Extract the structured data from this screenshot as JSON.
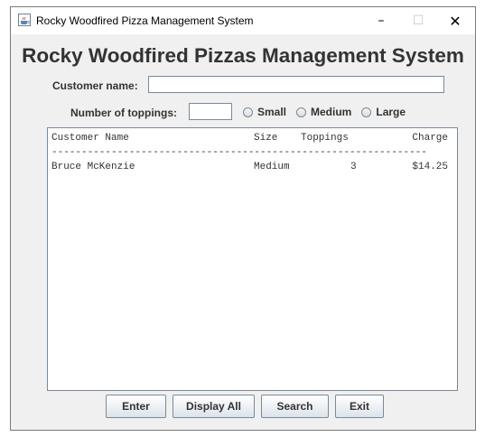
{
  "window": {
    "title": "Rocky Woodfired Pizza Management System",
    "minimize_glyph": "–",
    "maximize_glyph": "☐",
    "close_glyph": "✕",
    "icon": "java-coffee-icon"
  },
  "heading": "Rocky Woodfired Pizzas Management System",
  "form": {
    "customer_name_label": "Customer name:",
    "customer_name_value": "",
    "toppings_label": "Number of toppings:",
    "toppings_value": "",
    "size_options": [
      "Small",
      "Medium",
      "Large"
    ],
    "size_selected": null
  },
  "output": {
    "headers": {
      "name": "Customer Name",
      "size": "Size",
      "toppings": "Toppings",
      "charge": "Charge"
    },
    "divider": "---------------------------------------------------------------",
    "rows": [
      {
        "name": "Bruce McKenzie",
        "size": "Medium",
        "toppings": "3",
        "charge": "$14.25"
      }
    ]
  },
  "buttons": {
    "enter": "Enter",
    "display_all": "Display All",
    "search": "Search",
    "exit": "Exit"
  }
}
